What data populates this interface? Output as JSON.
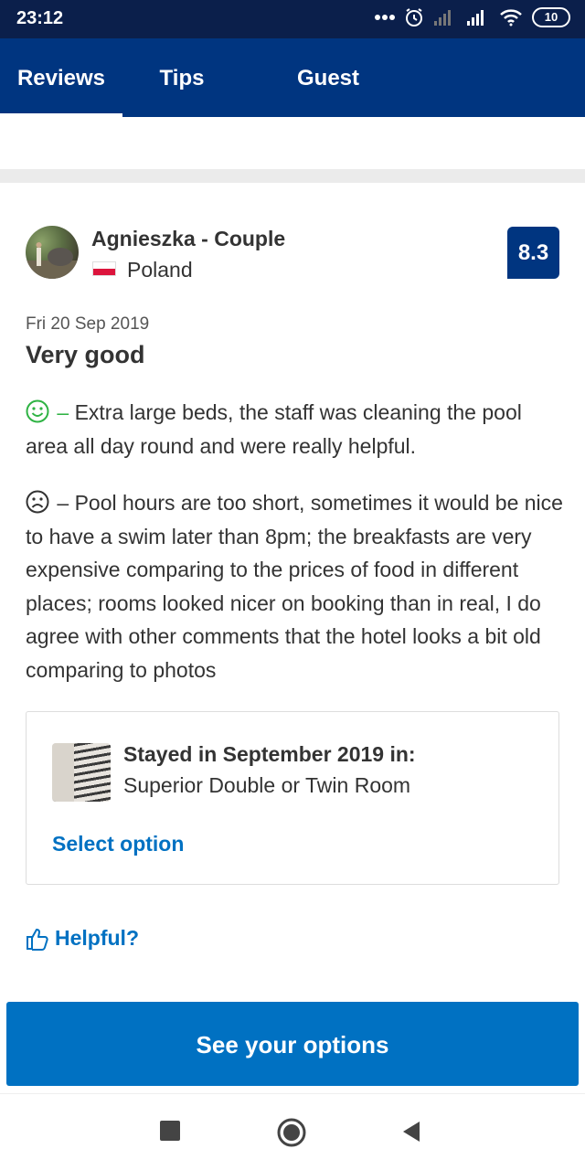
{
  "status_bar": {
    "time": "23:12",
    "battery": "10",
    "icons": [
      "more-dots-icon",
      "alarm-icon",
      "signal-icon",
      "signal-icon",
      "wifi-icon",
      "battery-icon"
    ]
  },
  "tabs": [
    {
      "label": "Reviews",
      "active": true
    },
    {
      "label": "Tips",
      "active": false
    },
    {
      "label": "Guest photos",
      "active": false
    }
  ],
  "review": {
    "reviewer_name": "Agnieszka - Couple",
    "country": "Poland",
    "score": "8.3",
    "date": "Fri 20 Sep 2019",
    "title": "Very good",
    "positive_prefix": " – ",
    "positive": "Extra large beds, the staff was cleaning the pool area all day round and were really helpful.",
    "negative_prefix": " – ",
    "negative": "Pool hours are too short, sometimes it would be nice to have a swim later than 8pm; the breakfasts are very expensive comparing to the prices of food in different places; rooms looked nicer on booking than in real, I do agree with other comments that the hotel looks a bit old comparing to photos"
  },
  "room_card": {
    "stayed_label": "Stayed in September 2019 in:",
    "room_name": "Superior Double or Twin Room",
    "select_label": "Select option"
  },
  "helpful_label": "Helpful?",
  "cta_label": "See your options",
  "colors": {
    "brand_dark": "#003580",
    "status_bar": "#0b1f4b",
    "accent_blue": "#0071c2",
    "positive_green": "#2fb344",
    "flag_red": "#dc143c"
  }
}
